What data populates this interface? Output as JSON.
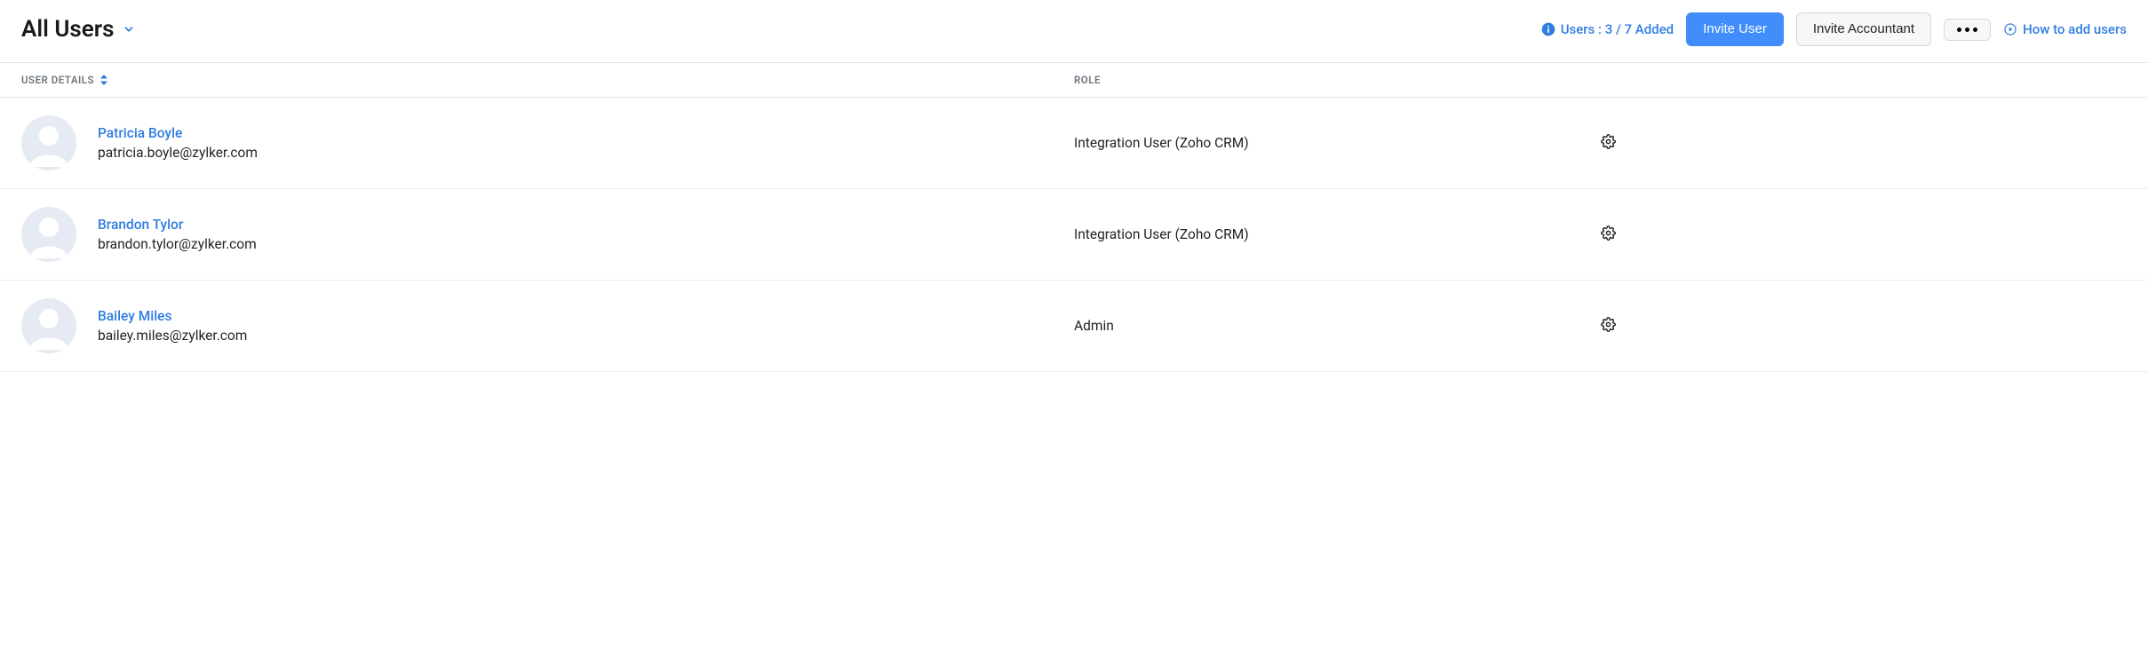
{
  "header": {
    "title": "All Users",
    "users_count_label": "Users : 3 / 7 Added",
    "invite_user_label": "Invite User",
    "invite_accountant_label": "Invite Accountant",
    "howto_label": "How to add users"
  },
  "columns": {
    "user_details": "USER DETAILS",
    "role": "ROLE"
  },
  "users": [
    {
      "name": "Patricia Boyle",
      "email": "patricia.boyle@zylker.com",
      "role": "Integration User (Zoho CRM)"
    },
    {
      "name": "Brandon Tylor",
      "email": "brandon.tylor@zylker.com",
      "role": "Integration User (Zoho CRM)"
    },
    {
      "name": "Bailey Miles",
      "email": "bailey.miles@zylker.com",
      "role": "Admin"
    }
  ]
}
